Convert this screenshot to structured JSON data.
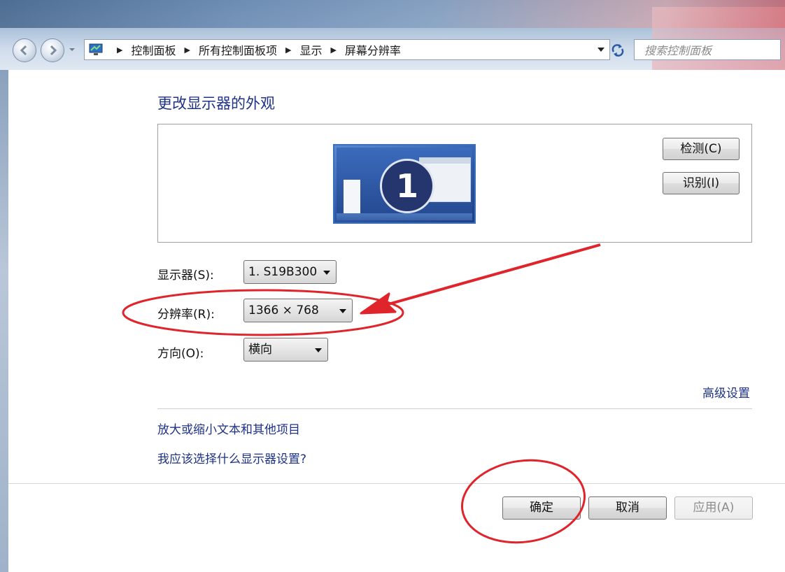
{
  "nav": {
    "breadcrumbs": [
      "控制面板",
      "所有控制面板项",
      "显示",
      "屏幕分辨率"
    ],
    "search_placeholder": "搜索控制面板"
  },
  "page": {
    "title": "更改显示器的外观",
    "preview": {
      "monitor_number": "1",
      "detect_label": "检测(C)",
      "identify_label": "识别(I)"
    },
    "display": {
      "label": "显示器(S):",
      "value": "1. S19B300"
    },
    "resolution": {
      "label": "分辨率(R):",
      "value": "1366 × 768"
    },
    "orientation": {
      "label": "方向(O):",
      "value": "横向"
    },
    "advanced_link": "高级设置",
    "links": [
      "放大或缩小文本和其他项目",
      "我应该选择什么显示器设置?"
    ],
    "buttons": {
      "ok": "确定",
      "cancel": "取消",
      "apply": "应用(A)"
    }
  },
  "colors": {
    "link": "#1e3287",
    "annotation": "#e0242b"
  }
}
